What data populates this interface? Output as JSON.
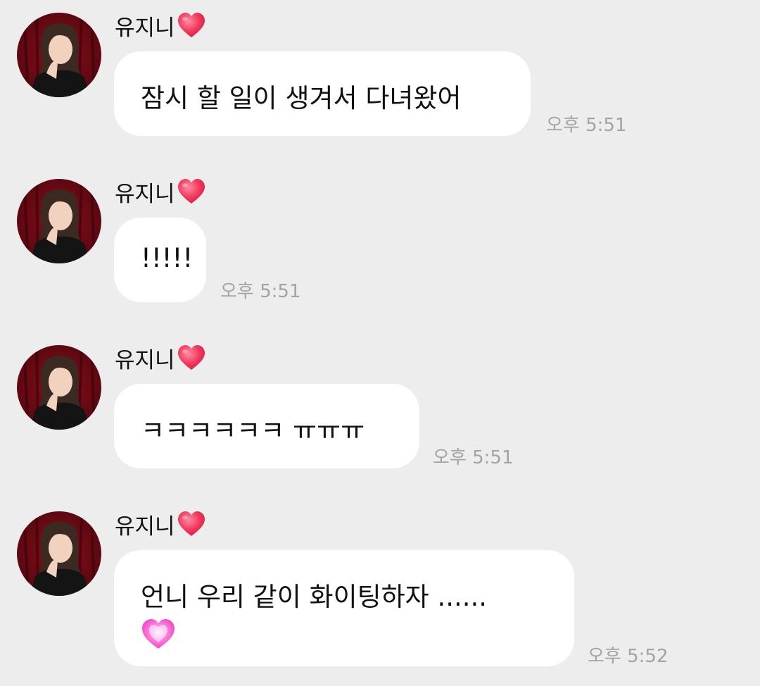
{
  "messages": [
    {
      "sender": "유지니",
      "text": "잠시 할 일이 생겨서 다녀왔어",
      "time": "오후 5:51"
    },
    {
      "sender": "유지니",
      "text": "!!!!!",
      "time": "오후 5:51"
    },
    {
      "sender": "유지니",
      "text": "ㅋㅋㅋㅋㅋㅋ ㅠㅠㅠ",
      "time": "오후 5:51"
    },
    {
      "sender": "유지니",
      "text": "언니 우리 같이 화이팅하자 ......",
      "emoji": "pink-heart",
      "time": "오후 5:52"
    }
  ],
  "colors": {
    "background": "#ededed",
    "bubble": "#ffffff",
    "timestamp": "#a3a3a3",
    "heart": "#f0365a",
    "pink_heart": "#ff5ccf"
  }
}
